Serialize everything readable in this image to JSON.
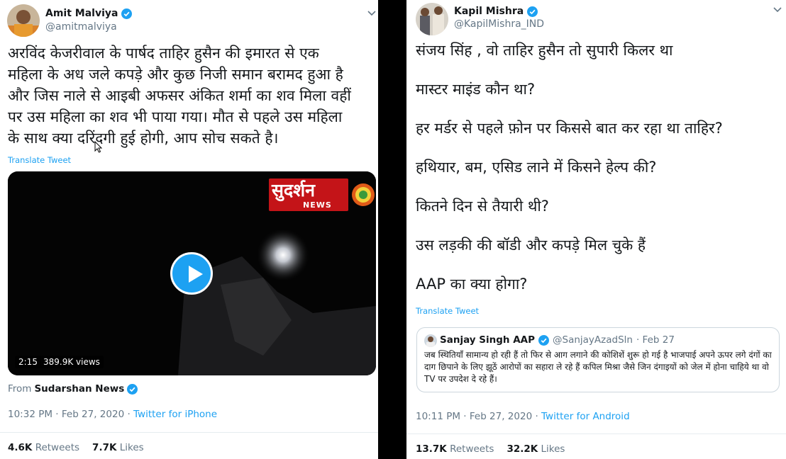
{
  "left_tweet": {
    "author_name": "Amit Malviya",
    "author_handle": "@amitmalviya",
    "text_lines": [
      "अरविंद केजरीवाल के पार्षद ताहिर हुसैन की इमारत से एक",
      "महिला के अध जले कपड़े और कुछ निजी समान बरामद हुआ है",
      "और जिस नाले से आइबी अफसर अंकित शर्मा का शव मिला वहीं",
      "पर उस महिला का शव भी पाया गया। मौत से पहले उस महिला",
      "के साथ क्या दरिंदगी हुई होगी, आप सोच सकते है।"
    ],
    "translate_label": "Translate Tweet",
    "video": {
      "channel_logo_text": "सुदर्शन",
      "channel_logo_sub": "NEWS",
      "duration": "2:15",
      "views": "389.9K views"
    },
    "from_prefix": "From",
    "from_source": "Sudarshan News",
    "time": "10:32 PM · Feb 27, 2020 · ",
    "client": "Twitter for iPhone",
    "retweets_count": "4.6K",
    "retweets_label": "Retweets",
    "likes_count": "7.7K",
    "likes_label": "Likes"
  },
  "right_tweet": {
    "author_name": "Kapil Mishra",
    "author_handle": "@KapilMishra_IND",
    "text_lines": [
      "संजय सिंह , वो ताहिर हुसैन तो सुपारी किलर था",
      "मास्टर माइंड कौन था?",
      "हर मर्डर से पहले फ़ोन पर किससे बात कर रहा था ताहिर?",
      "हथियार, बम, एसिड लाने में किसने हेल्प की?",
      "कितने दिन से तैयारी थी?",
      "उस  लड़की की बॉडी और कपड़े मिल चुके हैं",
      "AAP का क्या होगा?"
    ],
    "translate_label": "Translate Tweet",
    "quoted": {
      "author_name": "Sanjay Singh AAP",
      "author_handle": "@SanjayAzadSln",
      "date": "· Feb 27",
      "text": "जब स्थितियाँ सामान्य हो रही हैं तो फिर से आग लगाने की कोशिशें शुरू हो गई है भाजपाई अपने ऊपर लगे दंगों का दाग छिपाने के लिए झूठें आरोपों का सहारा ले रहे हैं कपिल मिश्रा जैसे जिन दंगाइयों को जेल में होना चाहिये था वो TV पर उपदेश दे रहे हैं।"
    },
    "time": "10:11 PM · Feb 27, 2020 · ",
    "client": "Twitter for Android",
    "retweets_count": "13.7K",
    "retweets_label": "Retweets",
    "likes_count": "32.2K",
    "likes_label": "Likes"
  },
  "icons": [
    "verified-badge-icon",
    "chevron-down-icon",
    "play-icon",
    "mouse-cursor-icon",
    "sudarshan-logo-icon"
  ],
  "colors": {
    "link_blue": "#1da1f2",
    "text_dark": "#14171a",
    "text_gray": "#657786",
    "divider_black": "#000000",
    "logo_red": "#c41418"
  }
}
